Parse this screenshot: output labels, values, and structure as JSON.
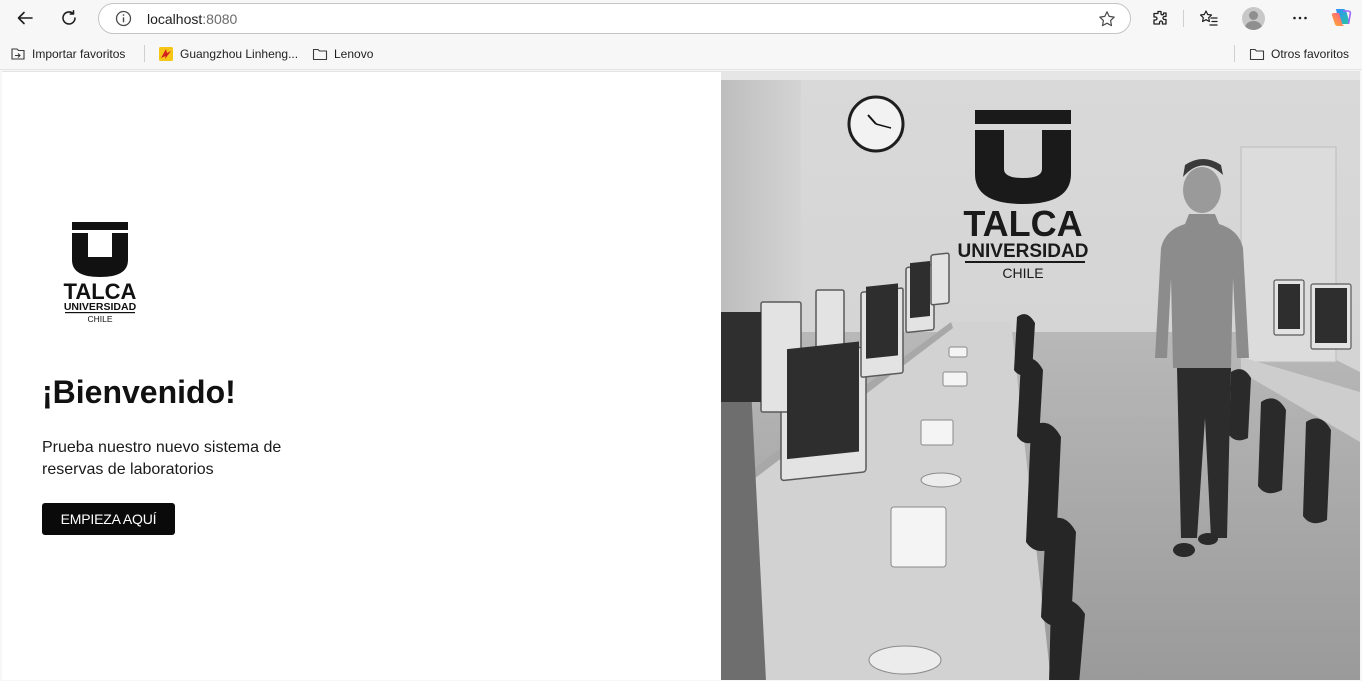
{
  "browser": {
    "url_host": "localhost",
    "url_port": ":8080",
    "icons": {
      "back": "back-arrow-icon",
      "reload": "reload-icon",
      "info": "site-info-icon",
      "favorite": "star-icon",
      "extensions": "extensions-icon",
      "favorites_menu": "favorites-icon",
      "profile": "profile-avatar-icon",
      "more": "more-icon",
      "copilot": "copilot-icon"
    }
  },
  "bookmarks_bar": {
    "items": [
      {
        "label": "Importar favoritos",
        "icon": "import-icon"
      },
      {
        "label": "Guangzhou Linheng...",
        "icon": "site-favicon-icon"
      },
      {
        "label": "Lenovo",
        "icon": "folder-icon"
      }
    ],
    "other": {
      "label": "Otros favoritos",
      "icon": "folder-icon"
    }
  },
  "page": {
    "logo": {
      "line1": "TALCA",
      "line2": "UNIVERSIDAD",
      "line3": "CHILE"
    },
    "title": "¡Bienvenido!",
    "subtitle": "Prueba nuestro nuevo sistema de reservas de laboratorios",
    "cta_label": "EMPIEZA AQUÍ",
    "hero_image": {
      "description_icon": "computer-lab-photo",
      "logo_line1": "TALCA",
      "logo_line2": "UNIVERSIDAD",
      "logo_line3": "CHILE"
    }
  },
  "colors": {
    "button_bg": "#0a0a0a",
    "button_text": "#ffffff",
    "page_bg": "#ffffff",
    "chrome_bg": "#f7f7f7"
  }
}
